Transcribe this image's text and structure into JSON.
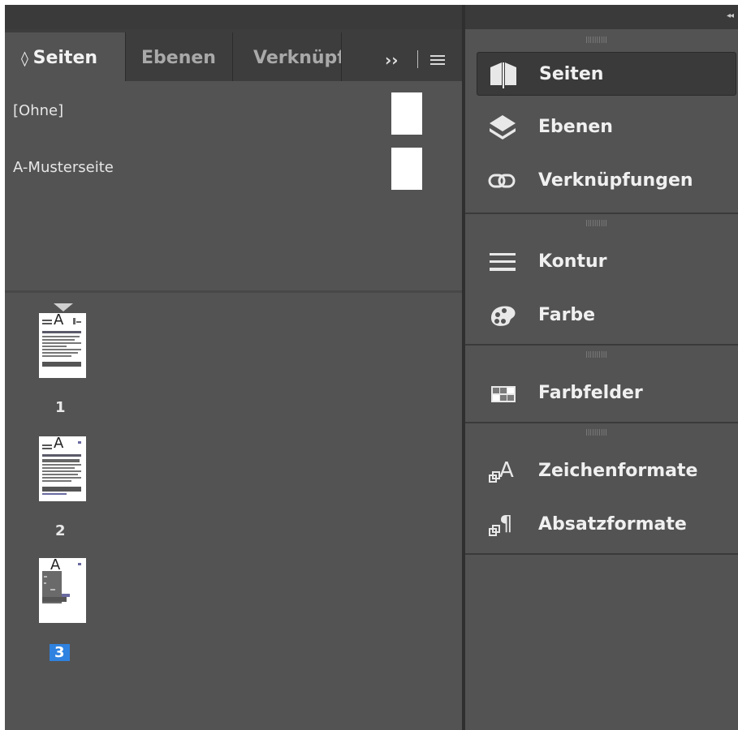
{
  "dock": {
    "collapse_icon": "double-chevron-left-icon"
  },
  "left_panel": {
    "tabs": [
      {
        "label": "Seiten",
        "prefix": "◊ ",
        "active": true
      },
      {
        "label": "Ebenen",
        "prefix": "",
        "active": false
      },
      {
        "label": "Verknüpf",
        "prefix": "",
        "active": false
      }
    ],
    "overflow_label": "››",
    "menu_icon": "hamburger-menu-icon",
    "masters": [
      {
        "label": "[Ohne]"
      },
      {
        "label": "A-Musterseite"
      }
    ],
    "pages": [
      {
        "number": "1",
        "master_prefix": "A",
        "selected": false
      },
      {
        "number": "2",
        "master_prefix": "A",
        "selected": false
      },
      {
        "number": "3",
        "master_prefix": "A",
        "selected": true
      }
    ]
  },
  "right_panel": {
    "groups": [
      {
        "items": [
          {
            "label": "Seiten",
            "icon": "pages-icon",
            "active": true
          },
          {
            "label": "Ebenen",
            "icon": "layers-icon",
            "active": false
          },
          {
            "label": "Verknüpfungen",
            "icon": "link-icon",
            "active": false
          }
        ]
      },
      {
        "items": [
          {
            "label": "Kontur",
            "icon": "stroke-icon",
            "active": false
          },
          {
            "label": "Farbe",
            "icon": "palette-icon",
            "active": false
          }
        ]
      },
      {
        "items": [
          {
            "label": "Farbfelder",
            "icon": "swatches-icon",
            "active": false
          }
        ]
      },
      {
        "items": [
          {
            "label": "Zeichenformate",
            "icon": "character-styles-icon",
            "active": false
          },
          {
            "label": "Absatzformate",
            "icon": "paragraph-styles-icon",
            "active": false
          }
        ]
      }
    ]
  },
  "colors": {
    "panel_bg": "#535353",
    "tab_bg": "#3d3d3d",
    "selection": "#2f82e0"
  }
}
